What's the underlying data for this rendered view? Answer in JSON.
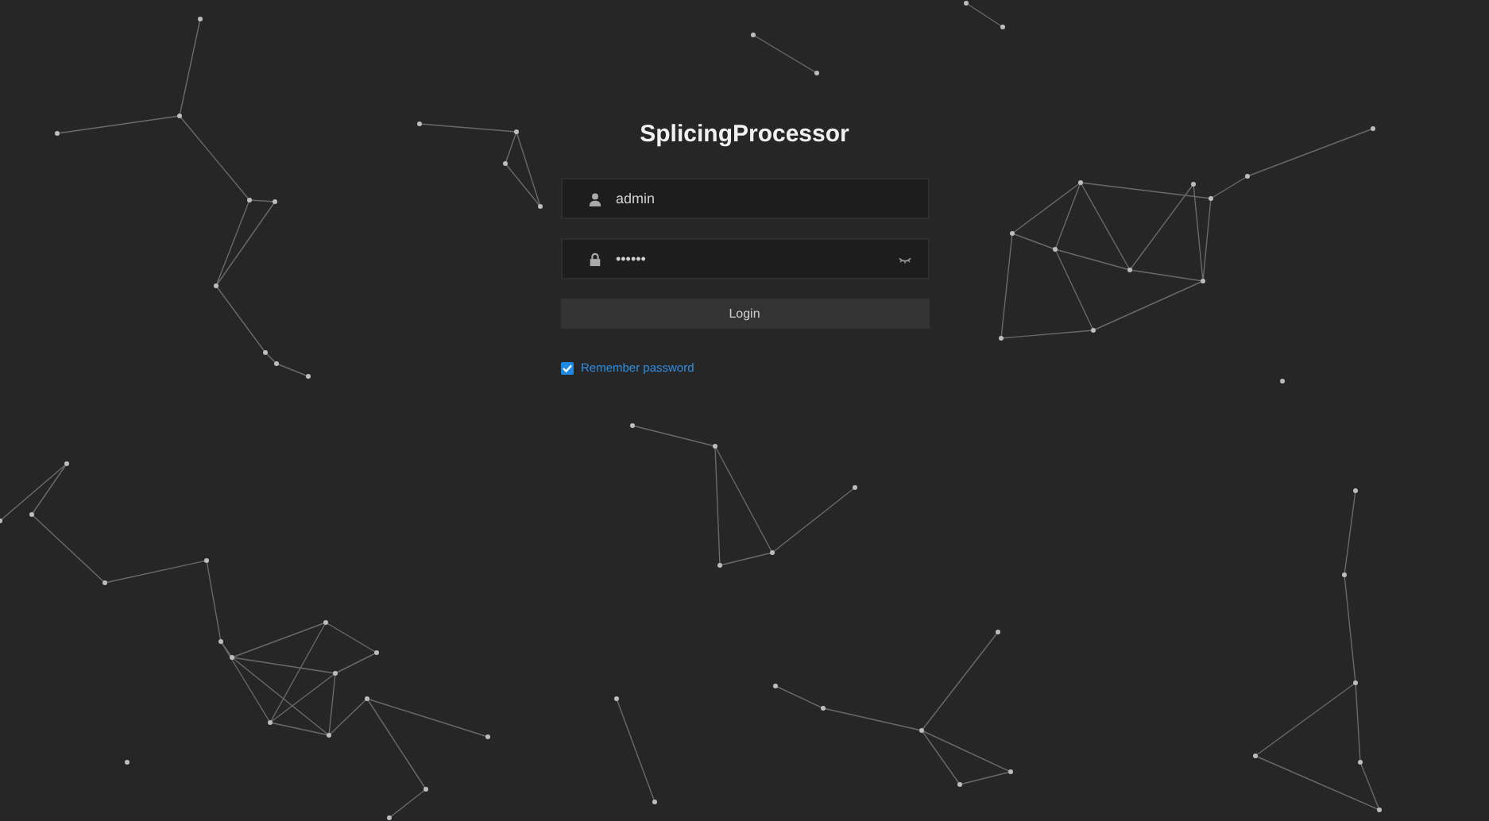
{
  "title": "SplicingProcessor",
  "username": {
    "value": "admin"
  },
  "password": {
    "value": "••••••"
  },
  "login_button": {
    "label": "Login"
  },
  "remember_password": {
    "label": "Remember password",
    "checked": true
  }
}
